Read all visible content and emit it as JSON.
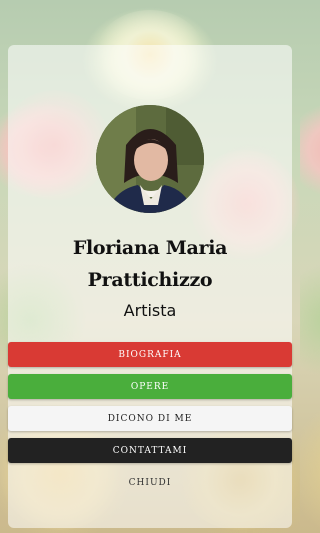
{
  "profile": {
    "name": "Floriana Maria Prattichizzo",
    "role": "Artista"
  },
  "menu": {
    "biografia": "BIOGRAFIA",
    "opere": "OPERE",
    "dicono_di_me": "DICONO DI ME",
    "contattami": "CONTATTAMI",
    "chiudi": "CHIUDI"
  },
  "colors": {
    "biografia": "#d93a34",
    "opere": "#4aae3c",
    "dicono_di_me": "#f5f5f5",
    "contattami": "#222222"
  }
}
